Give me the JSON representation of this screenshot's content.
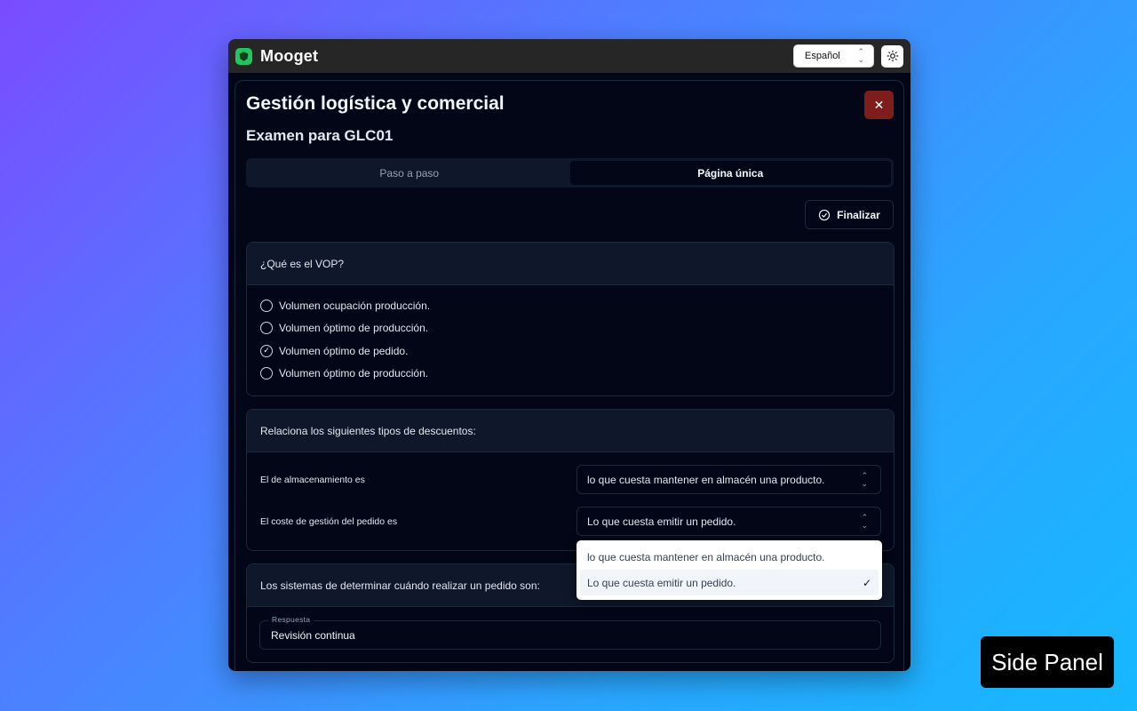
{
  "app": {
    "name": "Mooget",
    "language": "Español"
  },
  "exam": {
    "title": "Gestión logística y comercial",
    "subtitle": "Examen para GLC01",
    "tabs": [
      {
        "label": "Paso a paso",
        "active": false
      },
      {
        "label": "Página única",
        "active": true
      }
    ],
    "finish_label": "Finalizar"
  },
  "questions": [
    {
      "prompt": "¿Qué es el VOP?",
      "options": [
        {
          "label": "Volumen ocupación producción.",
          "checked": false
        },
        {
          "label": "Volumen óptimo de producción.",
          "checked": false
        },
        {
          "label": "Volumen óptimo de pedido.",
          "checked": true
        },
        {
          "label": "Volumen óptimo de producción.",
          "checked": false
        }
      ]
    },
    {
      "prompt": "Relaciona los siguientes tipos de descuentos:",
      "pairs": [
        {
          "label": "El de almacenamiento es",
          "value": "lo que cuesta mantener en almacén una producto."
        },
        {
          "label": "El coste de gestión del pedido es",
          "value": "Lo que cuesta emitir un pedido."
        }
      ]
    },
    {
      "prompt": "Los sistemas de determinar cuándo realizar un pedido son:",
      "answer_legend": "Respuesta",
      "answer_value": "Revisión continua"
    }
  ],
  "dropdown": {
    "options": [
      {
        "label": "lo que cuesta mantener en almacén una producto.",
        "selected": false
      },
      {
        "label": "Lo que cuesta emitir un pedido.",
        "selected": true
      }
    ],
    "check_glyph": "✓"
  },
  "side_panel_label": "Side Panel",
  "colors": {
    "accent_logo": "#22c55e",
    "close_button": "#7f1d1d",
    "panel_bg": "#020617",
    "topbar_bg": "#262626"
  }
}
